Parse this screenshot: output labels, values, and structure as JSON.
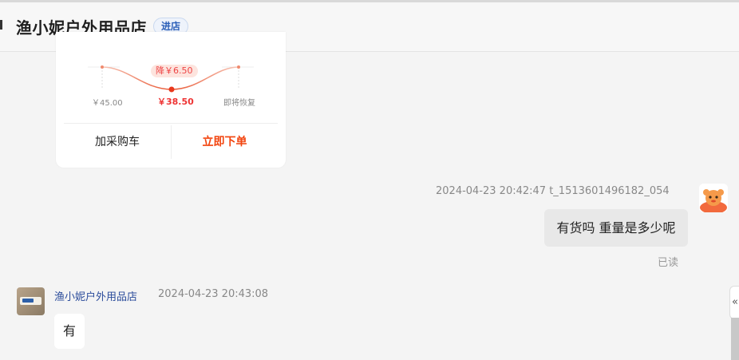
{
  "header": {
    "shop_name": "渔小妮户外用品店",
    "enter_badge": "进店"
  },
  "product_card": {
    "price_drop_tag": "降￥6.50",
    "original_price": "￥45.00",
    "current_price": "￥38.50",
    "restore_label": "即将恢复",
    "add_to_cart_label": "加采购车",
    "buy_now_label": "立即下单",
    "accent_color": "#f2440e"
  },
  "messages": [
    {
      "side": "right",
      "meta": "2024-04-23 20:42:47  t_1513601496182_054",
      "text": "有货吗 重量是多少呢",
      "status": "已读"
    },
    {
      "side": "left",
      "sender": "渔小妮户外用品店",
      "time": "2024-04-23 20:43:08",
      "text": "有"
    }
  ],
  "sidebar": {
    "toggle_glyph": "«"
  }
}
